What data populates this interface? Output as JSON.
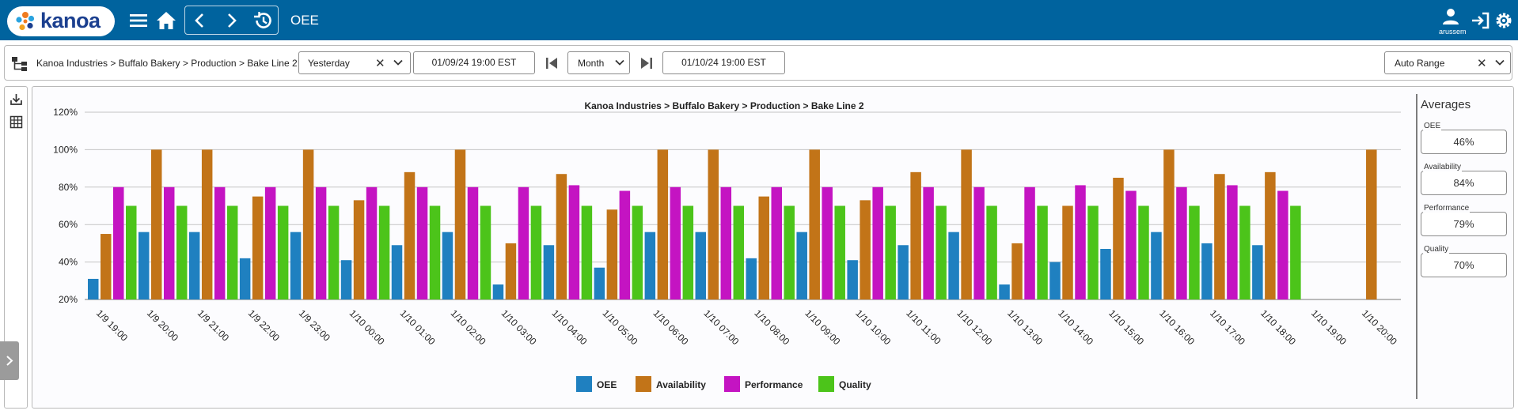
{
  "app": {
    "brand": "kanoa",
    "page_title": "OEE",
    "user": "arussem"
  },
  "filter_bar": {
    "breadcrumb": "Kanoa Industries > Buffalo Bakery > Production > Bake Line 2",
    "period_select": "Yesterday",
    "start_date": "01/09/24 19:00 EST",
    "granularity": "Month",
    "end_date": "01/10/24 19:00 EST",
    "range_select": "Auto Range"
  },
  "averages": {
    "title": "Averages",
    "items": [
      {
        "label": "OEE",
        "value": "46%"
      },
      {
        "label": "Availability",
        "value": "84%"
      },
      {
        "label": "Performance",
        "value": "79%"
      },
      {
        "label": "Quality",
        "value": "70%"
      }
    ]
  },
  "colors": {
    "OEE": "#1f80c0",
    "Availability": "#c27418",
    "Performance": "#c414c2",
    "Quality": "#4cc41a",
    "header": "#00639e"
  },
  "chart_data": {
    "type": "bar",
    "title": "Kanoa Industries > Buffalo Bakery > Production > Bake Line 2",
    "xlabel": "",
    "ylabel": "",
    "ylim": [
      20,
      120
    ],
    "yticks": [
      "20%",
      "40%",
      "60%",
      "80%",
      "100%",
      "120%"
    ],
    "grid": true,
    "legend_position": "bottom",
    "categories": [
      "1/9 19:00",
      "1/9 20:00",
      "1/9 21:00",
      "1/9 22:00",
      "1/9 23:00",
      "1/10 00:00",
      "1/10 01:00",
      "1/10 02:00",
      "1/10 03:00",
      "1/10 04:00",
      "1/10 05:00",
      "1/10 06:00",
      "1/10 07:00",
      "1/10 08:00",
      "1/10 09:00",
      "1/10 10:00",
      "1/10 11:00",
      "1/10 12:00",
      "1/10 13:00",
      "1/10 14:00",
      "1/10 15:00",
      "1/10 16:00",
      "1/10 17:00",
      "1/10 18:00",
      "1/10 19:00",
      "1/10 20:00"
    ],
    "series": [
      {
        "name": "OEE",
        "values": [
          31,
          56,
          56,
          42,
          56,
          41,
          49,
          56,
          28,
          49,
          37,
          56,
          56,
          42,
          56,
          41,
          49,
          56,
          28,
          40,
          47,
          56,
          50,
          49,
          null,
          null
        ]
      },
      {
        "name": "Availability",
        "values": [
          55,
          100,
          100,
          75,
          100,
          73,
          88,
          100,
          50,
          87,
          68,
          100,
          100,
          75,
          100,
          73,
          88,
          100,
          50,
          70,
          85,
          100,
          87,
          88,
          null,
          100
        ]
      },
      {
        "name": "Performance",
        "values": [
          80,
          80,
          80,
          80,
          80,
          80,
          80,
          80,
          80,
          81,
          78,
          80,
          80,
          80,
          80,
          80,
          80,
          80,
          80,
          81,
          78,
          80,
          81,
          78,
          null,
          null
        ]
      },
      {
        "name": "Quality",
        "values": [
          70,
          70,
          70,
          70,
          70,
          70,
          70,
          70,
          70,
          70,
          70,
          70,
          70,
          70,
          70,
          70,
          70,
          70,
          70,
          70,
          70,
          70,
          70,
          70,
          null,
          null
        ]
      }
    ]
  }
}
